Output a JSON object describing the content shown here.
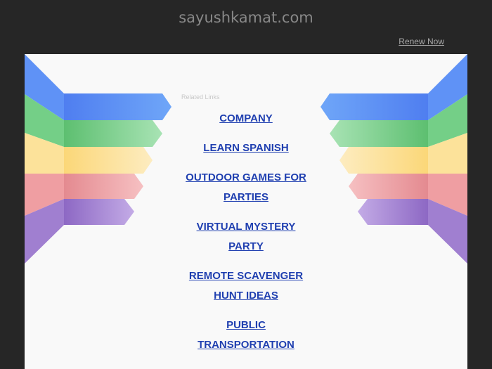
{
  "header": {
    "site_title": "sayushkamat.com",
    "renew_label": "Renew Now"
  },
  "main": {
    "related_label": "Related Links",
    "links": [
      "COMPANY",
      "LEARN SPANISH",
      "OUTDOOR GAMES FOR PARTIES",
      "VIRTUAL MYSTERY PARTY",
      "REMOTE SCAVENGER HUNT IDEAS",
      "PUBLIC TRANSPORTATION"
    ]
  },
  "colors": {
    "background": "#262626",
    "panel": "#f9f9f9",
    "link": "#1f3fb0",
    "bands": [
      "#5b8cf5",
      "#67c97b",
      "#fce49a",
      "#ef9fa3",
      "#a07fd0"
    ]
  }
}
